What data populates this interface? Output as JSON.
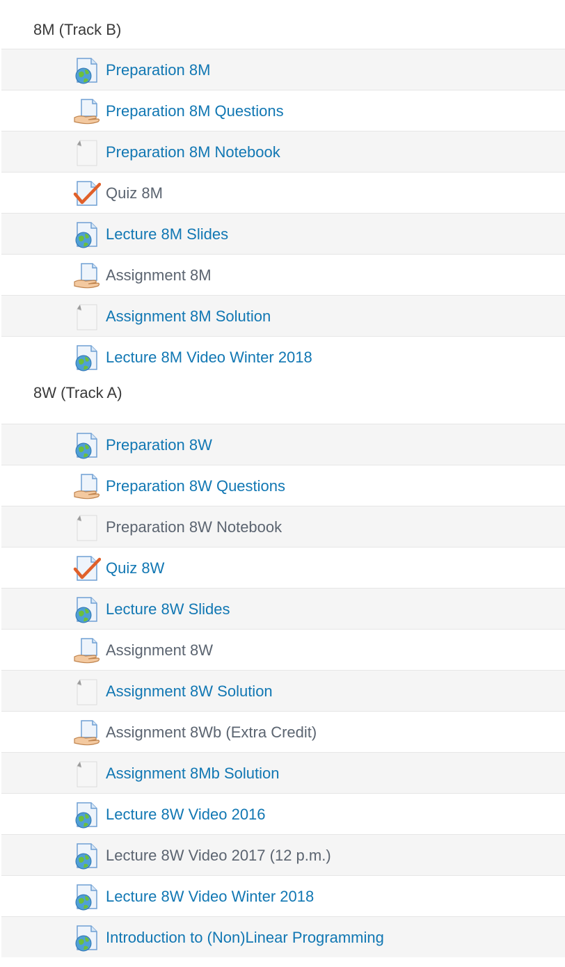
{
  "sections": [
    {
      "title": "8M (Track B)",
      "items": [
        {
          "label": "Preparation 8M",
          "icon": "url-globe-icon",
          "style": "link"
        },
        {
          "label": "Preparation 8M Questions",
          "icon": "assignment-hand-icon",
          "style": "link"
        },
        {
          "label": "Preparation 8M Notebook",
          "icon": "file-page-icon",
          "style": "link"
        },
        {
          "label": "Quiz 8M",
          "icon": "quiz-check-icon",
          "style": "dim"
        },
        {
          "label": "Lecture 8M Slides",
          "icon": "url-globe-icon",
          "style": "link"
        },
        {
          "label": "Assignment 8M",
          "icon": "assignment-hand-icon",
          "style": "dim"
        },
        {
          "label": "Assignment 8M Solution",
          "icon": "file-page-icon",
          "style": "link"
        },
        {
          "label": "Lecture 8M Video Winter 2018",
          "icon": "url-globe-icon",
          "style": "link"
        }
      ]
    },
    {
      "title": "8W (Track A)",
      "items": [
        {
          "label": "Preparation 8W",
          "icon": "url-globe-icon",
          "style": "link"
        },
        {
          "label": "Preparation 8W Questions",
          "icon": "assignment-hand-icon",
          "style": "link"
        },
        {
          "label": "Preparation 8W Notebook",
          "icon": "file-page-icon",
          "style": "dim"
        },
        {
          "label": "Quiz 8W",
          "icon": "quiz-check-icon",
          "style": "link"
        },
        {
          "label": "Lecture 8W Slides",
          "icon": "url-globe-icon",
          "style": "link"
        },
        {
          "label": "Assignment 8W",
          "icon": "assignment-hand-icon",
          "style": "dim"
        },
        {
          "label": "Assignment 8W Solution",
          "icon": "file-page-icon",
          "style": "link"
        },
        {
          "label": "Assignment 8Wb (Extra Credit)",
          "icon": "assignment-hand-icon",
          "style": "dim"
        },
        {
          "label": "Assignment 8Mb Solution",
          "icon": "file-page-icon",
          "style": "link"
        },
        {
          "label": "Lecture 8W Video 2016",
          "icon": "url-globe-icon",
          "style": "link"
        },
        {
          "label": "Lecture 8W Video 2017 (12 p.m.)",
          "icon": "url-globe-icon",
          "style": "dim"
        },
        {
          "label": "Lecture 8W Video Winter 2018",
          "icon": "url-globe-icon",
          "style": "link"
        },
        {
          "label": "Introduction to (Non)Linear Programming",
          "icon": "url-globe-icon",
          "style": "link"
        }
      ]
    }
  ],
  "colors": {
    "link": "#1177b3",
    "dim": "#5b6470",
    "header": "#3a3a3a",
    "row_alt": "#f5f5f5",
    "divider": "#e6e6e6"
  }
}
